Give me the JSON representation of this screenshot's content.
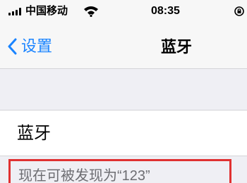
{
  "status_bar": {
    "carrier": "中国移动",
    "time": "08:35",
    "icons": [
      "signal-icon",
      "wifi-icon",
      "orientation-lock-icon"
    ]
  },
  "nav": {
    "back_label": "设置",
    "title": "蓝牙"
  },
  "bluetooth_row": {
    "label": "蓝牙"
  },
  "discoverable_text": "现在可被发现为“123”",
  "colors": {
    "accent": "#1a84ff",
    "highlight": "#e03131",
    "background": "#efeff4"
  }
}
